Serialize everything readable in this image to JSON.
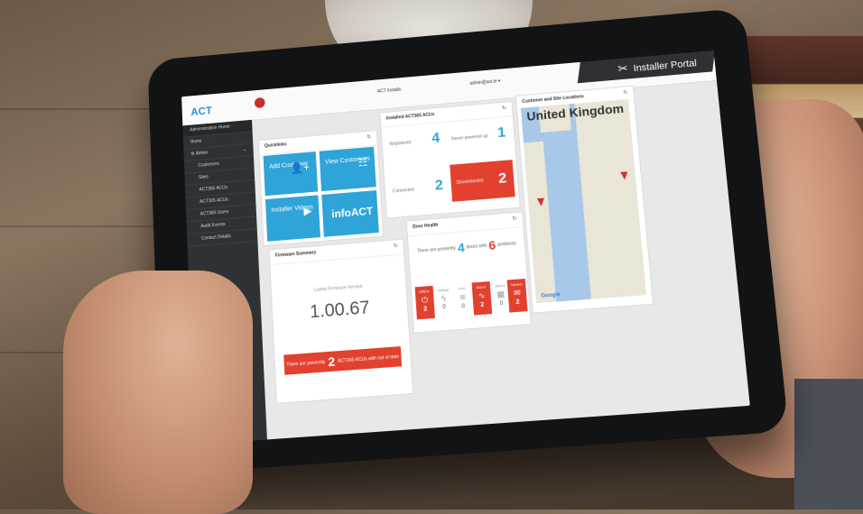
{
  "topbar": {
    "title": "ACT Installs",
    "user": "admin@act.ie ▾",
    "portal_label": "Installer Portal",
    "portal_icon": "wrench-screwdriver-icon"
  },
  "sidebar": {
    "items": [
      {
        "label": "Administration Home"
      },
      {
        "label": "Home"
      },
      {
        "label": "⚙ Admin"
      },
      {
        "label": "Customers"
      },
      {
        "label": "Sites"
      },
      {
        "label": "ACT365 ACUs"
      },
      {
        "label": "ACT365 ACUs"
      },
      {
        "label": "ACT365 Users"
      },
      {
        "label": "Audit Events"
      },
      {
        "label": "Contact Details"
      }
    ]
  },
  "quicklinks": {
    "title": "Quicklinks",
    "tiles": [
      {
        "label": "Add Customer",
        "icon": "add-user-icon"
      },
      {
        "label": "View Customers",
        "icon": "grid-list-icon"
      },
      {
        "label": "Installer Videos",
        "icon": "play-icon"
      },
      {
        "label": "infoACT",
        "icon": ""
      }
    ]
  },
  "installed": {
    "title": "Installed ACT365 ACUs",
    "registered_label": "Registered",
    "registered_value": "4",
    "never_label": "Never powered up",
    "never_value": "1",
    "connected_label": "Connected",
    "connected_value": "2",
    "disconnected_label": "Disconnected",
    "disconnected_value": "2"
  },
  "firmware": {
    "title": "Firmware Summary",
    "latest_label": "Latest Firmware Version",
    "version": "1.00.67",
    "alert_prefix": "There are presently",
    "alert_count": "2",
    "alert_suffix": "ACT365 ACUs with out of date firmware"
  },
  "door_health": {
    "title": "Door Health",
    "prefix": "There are presently",
    "doors": "4",
    "middle": "doors with",
    "problems": "6",
    "suffix": "problems",
    "tiles": [
      {
        "label": "Offline",
        "icon": "power-icon",
        "count": "2",
        "state": "red"
      },
      {
        "label": "Voltage",
        "icon": "lightning-icon",
        "count": "0",
        "state": "grey"
      },
      {
        "label": "PSU",
        "icon": "psu-icon",
        "count": "0",
        "state": "grey"
      },
      {
        "label": "Alarm",
        "icon": "wave-icon",
        "count": "2",
        "state": "red"
      },
      {
        "label": "Status",
        "icon": "chip-icon",
        "count": "0",
        "state": "grey"
      },
      {
        "label": "Tamper",
        "icon": "chat-icon",
        "count": "2",
        "state": "red"
      }
    ]
  },
  "map": {
    "title": "Customer and Site Locations",
    "country": "United Kingdom",
    "provider": "Google"
  }
}
